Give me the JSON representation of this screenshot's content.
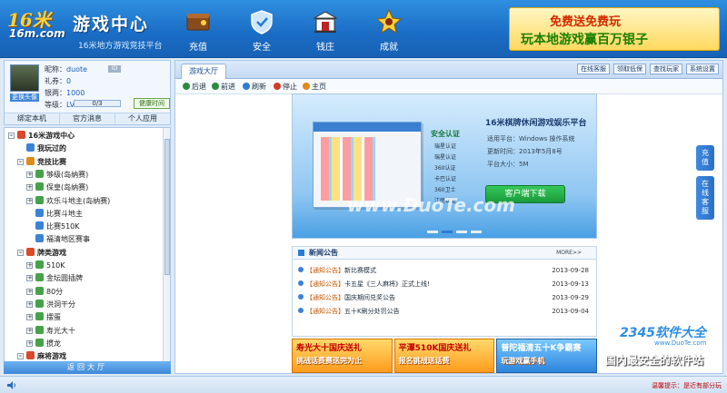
{
  "header": {
    "logo_text": "16米",
    "logo_sub": "16m.com",
    "title": "游戏中心",
    "subtitle": "16米地方游戏竞技平台",
    "nav": [
      {
        "label": "充值",
        "icon": "wallet-icon"
      },
      {
        "label": "安全",
        "icon": "shield-icon"
      },
      {
        "label": "钱庄",
        "icon": "bank-icon"
      },
      {
        "label": "成就",
        "icon": "trophy-icon"
      }
    ],
    "banner_line1": "免费送免费玩",
    "banner_line2": "玩本地游戏赢百万银子"
  },
  "user": {
    "nickname_label": "昵称：",
    "nickname": "duote",
    "id_badge": "ID",
    "gift_label": "礼券：",
    "gift": "0",
    "silver_label": "银两：",
    "silver": "1000",
    "level_label": "等级：",
    "level": "LV1",
    "level_progress": "0/3",
    "level_fraction": 0,
    "health_btn": "健康时间",
    "avatar_btn": "更换头像",
    "tools": [
      "绑定本机",
      "官方消息",
      "个人应用"
    ]
  },
  "tree": {
    "items": [
      {
        "label": "16米游戏中心",
        "level": 0,
        "toggle": "-",
        "bold": true,
        "color": "#d84a2a"
      },
      {
        "label": "我玩过的",
        "level": 1,
        "toggle": "",
        "bold": true,
        "color": "#3c82d6"
      },
      {
        "label": "竞技比赛",
        "level": 1,
        "toggle": "-",
        "bold": true,
        "color": "#e08a1a"
      },
      {
        "label": "够级(岛纳赛)",
        "level": 2,
        "toggle": "+",
        "bold": false,
        "color": "#46a24a"
      },
      {
        "label": "保皇(岛纳赛)",
        "level": 2,
        "toggle": "+",
        "bold": false,
        "color": "#46a24a"
      },
      {
        "label": "欢乐斗地主(岛纳赛)",
        "level": 2,
        "toggle": "+",
        "bold": false,
        "color": "#46a24a"
      },
      {
        "label": "比赛斗地主",
        "level": 2,
        "toggle": "",
        "bold": false,
        "color": "#3c82d6"
      },
      {
        "label": "比赛510K",
        "level": 2,
        "toggle": "",
        "bold": false,
        "color": "#3c82d6"
      },
      {
        "label": "福清地区赛事",
        "level": 2,
        "toggle": "",
        "bold": false,
        "color": "#3c82d6"
      },
      {
        "label": "牌类游戏",
        "level": 1,
        "toggle": "-",
        "bold": true,
        "color": "#d84a2a"
      },
      {
        "label": "510K",
        "level": 2,
        "toggle": "+",
        "bold": false,
        "color": "#46a24a"
      },
      {
        "label": "金坛圆插牌",
        "level": 2,
        "toggle": "+",
        "bold": false,
        "color": "#46a24a"
      },
      {
        "label": "80分",
        "level": 2,
        "toggle": "+",
        "bold": false,
        "color": "#46a24a"
      },
      {
        "label": "洪洞干分",
        "level": 2,
        "toggle": "+",
        "bold": false,
        "color": "#46a24a"
      },
      {
        "label": "摆蛋",
        "level": 2,
        "toggle": "+",
        "bold": false,
        "color": "#46a24a"
      },
      {
        "label": "寿光大十",
        "level": 2,
        "toggle": "+",
        "bold": false,
        "color": "#46a24a"
      },
      {
        "label": "掼龙",
        "level": 2,
        "toggle": "+",
        "bold": false,
        "color": "#46a24a"
      },
      {
        "label": "麻将游戏",
        "level": 1,
        "toggle": "-",
        "bold": true,
        "color": "#d84a2a"
      }
    ],
    "back_label": "返回大厅"
  },
  "main": {
    "tab": "游戏大厅",
    "top_buttons": [
      "在线客服",
      "领取低保",
      "查找玩家",
      "系统设置"
    ],
    "toolbar": [
      {
        "label": "后退",
        "color": "#2b8a3e"
      },
      {
        "label": "前进",
        "color": "#2b8a3e"
      },
      {
        "label": "刷新",
        "color": "#2b7bd3"
      },
      {
        "label": "停止",
        "color": "#d33a2a"
      },
      {
        "label": "主页",
        "color": "#e08a1a"
      }
    ],
    "hero": {
      "title": "16米棋牌休闲游戏娱乐平台",
      "auth": "安全认证",
      "features": [
        "瑞星认证",
        "瑞星认证",
        "360认证",
        "卡巴认证",
        "360卫士",
        "江民认证"
      ],
      "info": [
        "适用平台：Windows 操作系统",
        "更新时间：2013年5月8号",
        "平台大小：5M"
      ],
      "download_btn": "客户端下载",
      "watermark": "www.DuoTe.com",
      "slide_count": 4,
      "active_slide": 1
    },
    "news": {
      "title": "新闻公告",
      "more": "MORE>>",
      "items": [
        {
          "tag": "【通知公告】",
          "text": "新比赛模式",
          "date": "2013-09-28"
        },
        {
          "tag": "【通知公告】",
          "text": "卡五星《三人麻将》正式上线!",
          "date": "2013-09-13"
        },
        {
          "tag": "【通知公告】",
          "text": "国庆期间兑奖公告",
          "date": "2013-09-29"
        },
        {
          "tag": "【通知公告】",
          "text": "五十K刷分处罚公告",
          "date": "2013-09-04"
        }
      ]
    },
    "promos": [
      {
        "line1": "寿光大十国庆送礼",
        "line2": "挑战话费赛送完为止",
        "style": "orange"
      },
      {
        "line1": "平潭510K国庆送礼",
        "line2": "报名挑战送话费",
        "style": "orange"
      },
      {
        "line1": "普陀福清五十K争霸赛",
        "line2": "玩游戏赢手机",
        "style": "blue"
      }
    ]
  },
  "side_tabs": [
    "充值",
    "在线客服"
  ],
  "watermark": {
    "brand": "2345软件大全",
    "url": "www.DuoTe.com",
    "slogan": "国内最安全的软件站"
  },
  "status": {
    "tip": "温馨提示：是近有部分玩"
  }
}
